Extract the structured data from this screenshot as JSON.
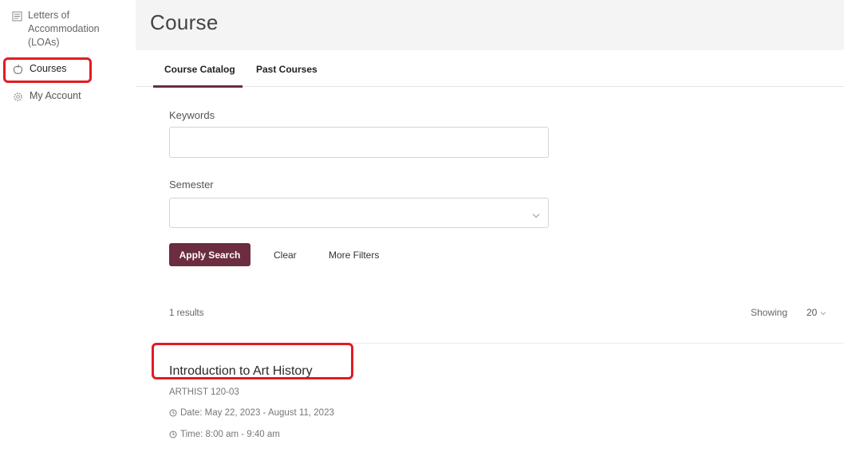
{
  "sidebar": {
    "items": [
      {
        "label": "Letters of Accommodation (LOAs)",
        "icon": "document-icon"
      },
      {
        "label": "Courses",
        "icon": "apple-icon"
      },
      {
        "label": "My Account",
        "icon": "gear-icon"
      }
    ]
  },
  "page": {
    "title": "Course"
  },
  "tabs": [
    {
      "label": "Course Catalog",
      "active": true
    },
    {
      "label": "Past Courses",
      "active": false
    }
  ],
  "filters": {
    "keywords_label": "Keywords",
    "keywords_value": "",
    "semester_label": "Semester",
    "semester_value": ""
  },
  "actions": {
    "apply_label": "Apply Search",
    "clear_label": "Clear",
    "more_filters_label": "More Filters"
  },
  "results": {
    "count_text": "1 results",
    "showing_label": "Showing",
    "page_size": "20"
  },
  "courses": [
    {
      "title": "Introduction to Art History",
      "code": "ARTHIST 120-03",
      "date": "Date: May 22, 2023 - August 11, 2023",
      "time": "Time: 8:00 am - 9:40 am"
    }
  ],
  "colors": {
    "accent": "#6b2d3f",
    "highlight": "#e31b23",
    "background": "#f4f4f4"
  }
}
